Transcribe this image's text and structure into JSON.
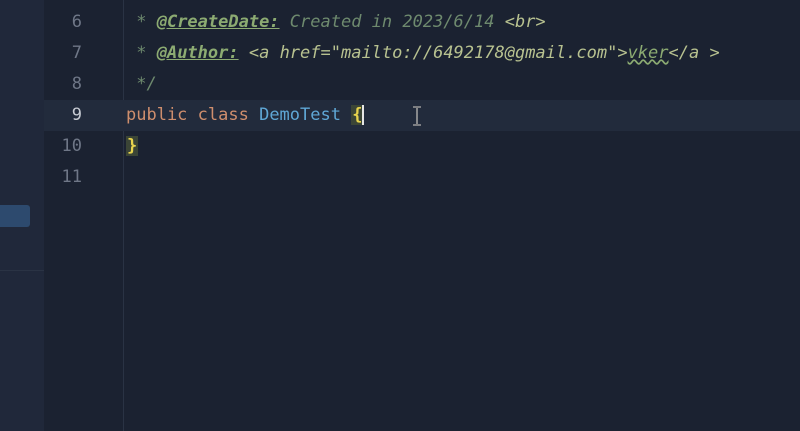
{
  "editor": {
    "lines": [
      {
        "number": "6",
        "parts": [
          {
            "text": " * ",
            "cls": "c-comment"
          },
          {
            "text": "@CreateDate:",
            "cls": "c-tag"
          },
          {
            "text": " Created in 2023/6/14 ",
            "cls": "c-comment"
          },
          {
            "text": "<br>",
            "cls": "c-html"
          }
        ]
      },
      {
        "number": "7",
        "parts": [
          {
            "text": " * ",
            "cls": "c-comment"
          },
          {
            "text": "@Author:",
            "cls": "c-tag"
          },
          {
            "text": " ",
            "cls": "c-comment"
          },
          {
            "text": "<a href=\"mailto://6492178@gmail.com\">",
            "cls": "c-html"
          },
          {
            "text": "vker",
            "cls": "c-squig"
          },
          {
            "text": "</a >",
            "cls": "c-html"
          }
        ]
      },
      {
        "number": "8",
        "parts": [
          {
            "text": " */",
            "cls": "c-comment"
          }
        ]
      },
      {
        "number": "9",
        "active": true,
        "parts": [
          {
            "text": "public ",
            "cls": "c-kw"
          },
          {
            "text": "class ",
            "cls": "c-kw"
          },
          {
            "text": "DemoTest ",
            "cls": "c-cls"
          },
          {
            "text": "{",
            "cls": "c-brace",
            "cursor_after": true
          }
        ]
      },
      {
        "number": "10",
        "parts": [
          {
            "text": "}",
            "cls": "c-brace"
          }
        ]
      },
      {
        "number": "11",
        "parts": []
      }
    ]
  },
  "colors": {
    "background": "#1b2231",
    "current_line": "#222b3c",
    "keyword": "#cf8e6d",
    "class_name": "#5fa7d6",
    "comment": "#6e8a6e",
    "brace_highlight": "#e8d44d"
  },
  "icons": {
    "text_cursor": "ibeam-cursor-icon"
  }
}
